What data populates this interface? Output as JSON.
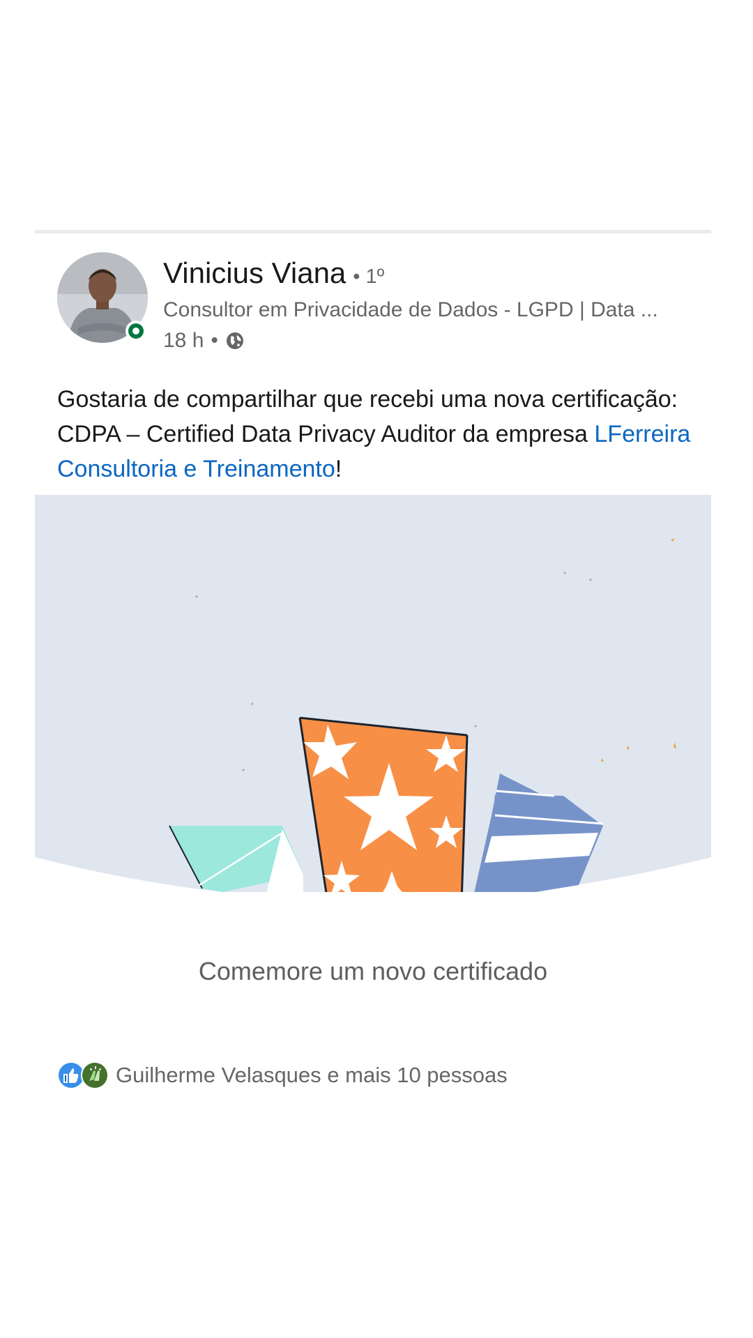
{
  "post": {
    "author": {
      "name": "Vinicius Viana",
      "degree": "• 1º",
      "headline": "Consultor em Privacidade de Dados - LGPD | Data ...",
      "time": "18 h",
      "visibility_separator": "•",
      "visibility_icon": "globe-icon",
      "avatar_icon": "profile-photo",
      "presence_color": "#057642"
    },
    "text_before_link": "Gostaria de compartilhar que recebi uma nova certificação: CDPA – Certified Data Privacy Auditor da empresa ",
    "link_text": "LFerreira Consultoria e Treinamento",
    "text_after_link": "!",
    "link_color": "#0a66c2"
  },
  "celebration": {
    "caption": "Comemore um novo certificado",
    "background_color": "#dfe6ef",
    "colors": {
      "orange": "#f78f46",
      "teal": "#9ce8dc",
      "blue": "#7693c9"
    }
  },
  "reactions": {
    "icons": [
      "like-icon",
      "celebrate-icon"
    ],
    "summary": "Guilherme Velasques e mais 10 pessoas"
  }
}
